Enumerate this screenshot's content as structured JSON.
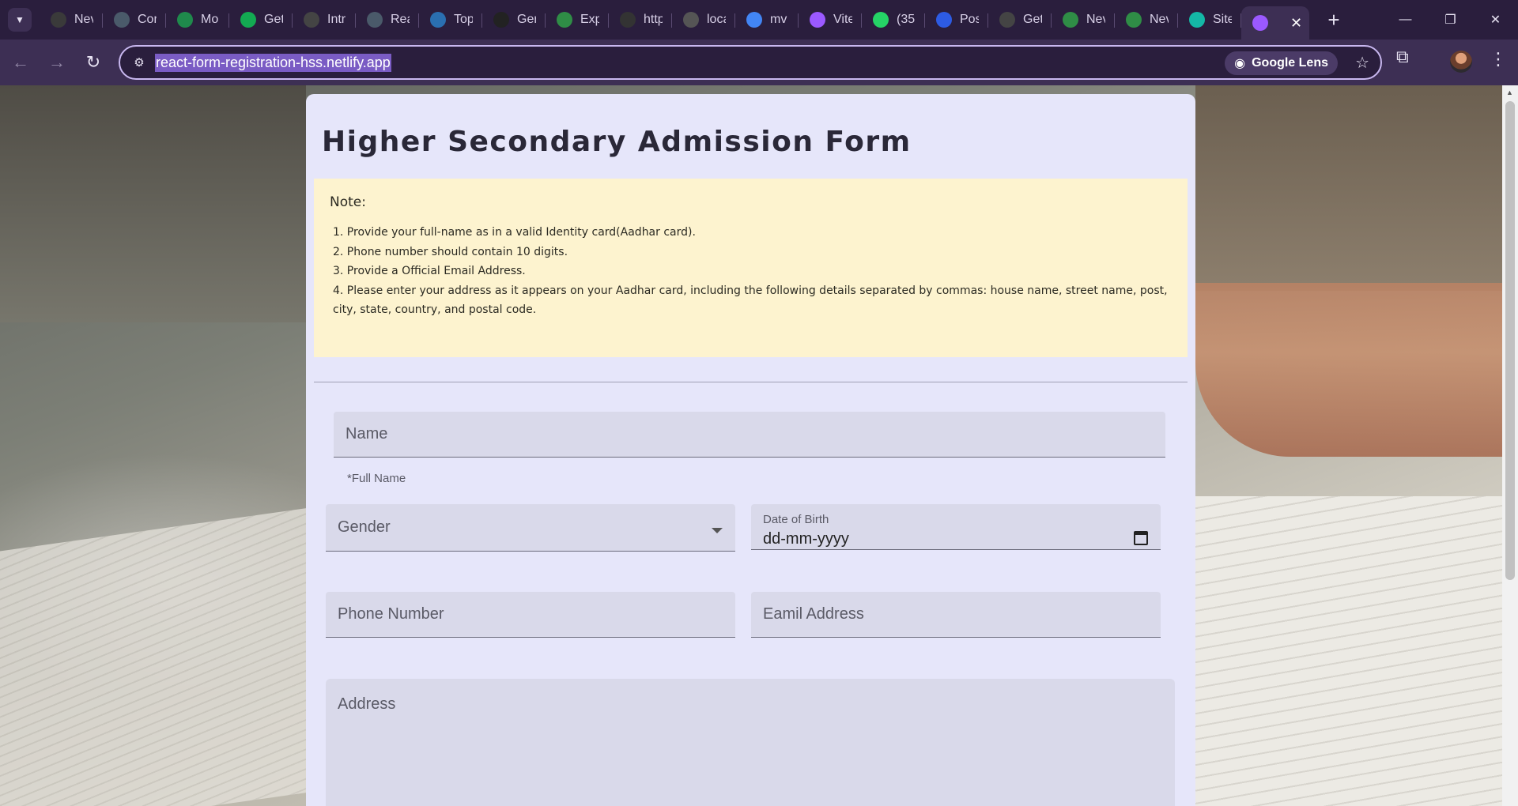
{
  "browser": {
    "tabs": [
      {
        "label": "Nev",
        "icon": "openai-icon",
        "color": "#3a3a3a"
      },
      {
        "label": "Cor",
        "icon": "netlify-triangle-icon",
        "color": "#4a5a6a"
      },
      {
        "label": "Mo",
        "icon": "w-logo-icon",
        "color": "#1f8a4c"
      },
      {
        "label": "Get",
        "icon": "mongodb-leaf-icon",
        "color": "#13aa52"
      },
      {
        "label": "Intr",
        "icon": "angular-a-icon",
        "color": "#444"
      },
      {
        "label": "Rea",
        "icon": "netlify-triangle-icon",
        "color": "#4a5a6a"
      },
      {
        "label": "Top",
        "icon": "mountain-icon",
        "color": "#2a6fb0"
      },
      {
        "label": "Ger",
        "icon": "github-icon",
        "color": "#222"
      },
      {
        "label": "Exp",
        "icon": "geeksforgeeks-icon",
        "color": "#2f8d46"
      },
      {
        "label": "http",
        "icon": "terminal-icon",
        "color": "#333"
      },
      {
        "label": "loca",
        "icon": "globe-icon",
        "color": "#555"
      },
      {
        "label": "mv",
        "icon": "google-icon",
        "color": "#4285f4"
      },
      {
        "label": "Vite",
        "icon": "vite-icon",
        "color": "#9b59ff"
      },
      {
        "label": "(35",
        "icon": "whatsapp-icon",
        "color": "#25d366"
      },
      {
        "label": "Pos",
        "icon": "zm-icon",
        "color": "#2d5be3"
      },
      {
        "label": "Get",
        "icon": "angular-a-icon",
        "color": "#444"
      },
      {
        "label": "Nev",
        "icon": "geeksforgeeks-icon",
        "color": "#2f8d46"
      },
      {
        "label": "Nev",
        "icon": "geeksforgeeks-icon",
        "color": "#2f8d46"
      },
      {
        "label": "Site",
        "icon": "netlify-diamond-icon",
        "color": "#14b8a6"
      }
    ],
    "active_tab_icon": "vite-icon",
    "url": "react-form-registration-hss.netlify.app",
    "lens_label": "Google Lens"
  },
  "form": {
    "title": "Higher Secondary Admission Form",
    "note_heading": "Note:",
    "notes": [
      "1. Provide your full-name as in a valid Identity card(Aadhar card).",
      "2. Phone number should contain 10 digits.",
      "3. Provide a Official Email Address.",
      "4. Please enter your address as it appears on your Aadhar card, including the following details separated by commas: house name, street name, post, city, state, country, and postal code."
    ],
    "name_label": "Name",
    "name_helper": "*Full Name",
    "gender_label": "Gender",
    "dob_label": "Date of Birth",
    "dob_placeholder": "dd-mm-yyyy",
    "phone_label": "Phone Number",
    "email_label": "Eamil Address",
    "address_label": "Address"
  }
}
